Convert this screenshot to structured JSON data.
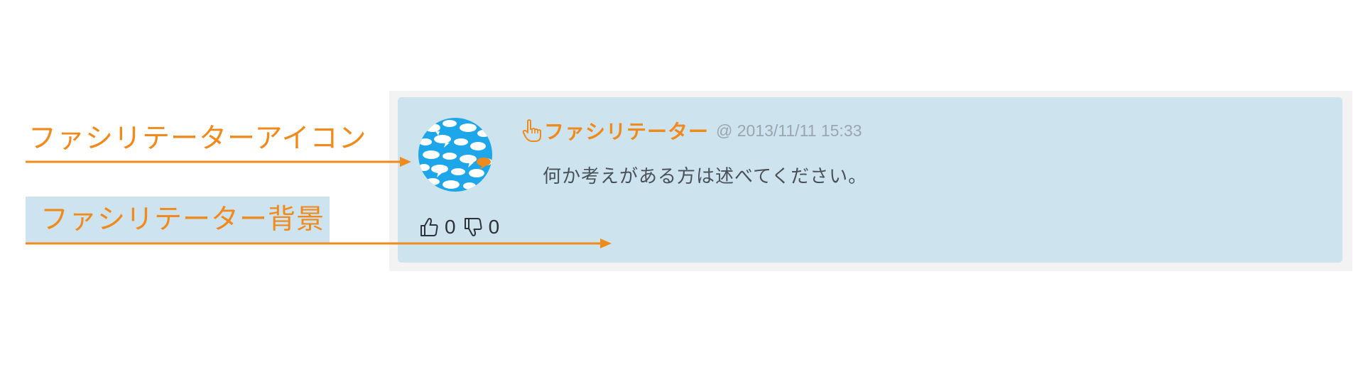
{
  "annotations": {
    "icon_label": "ファシリテーターアイコン",
    "background_label": "ファシリテーター背景",
    "arrow_color": "#f08a1c",
    "label_bg_color": "#cde3ef"
  },
  "comment": {
    "author": "ファシリテーター",
    "author_icon": "pointing-hand-icon",
    "timestamp": "@ 2013/11/11 15:33",
    "text": "何か考えがある方は述べてください。",
    "background_color": "#cde3ee",
    "author_color": "#f08a1c",
    "avatar": "speech-bubbles-avatar",
    "likes": "0",
    "dislikes": "0"
  }
}
